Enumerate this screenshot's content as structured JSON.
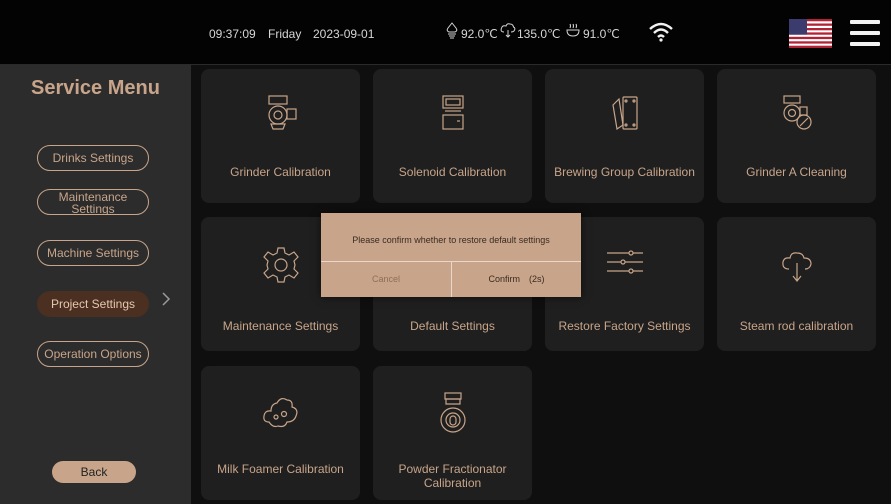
{
  "status": {
    "time": "09:37:09",
    "day": "Friday",
    "date": "2023-09-01",
    "temp1": "92.0℃",
    "temp2": "135.0℃",
    "temp3": "91.0℃"
  },
  "sidebar": {
    "title": "Service Menu",
    "items": [
      {
        "label": "Drinks Settings"
      },
      {
        "label": "Maintenance Settings"
      },
      {
        "label": "Machine Settings"
      },
      {
        "label": "Project Settings"
      },
      {
        "label": "Operation Options"
      }
    ],
    "back": "Back"
  },
  "tiles": [
    {
      "label": "Grinder Calibration",
      "icon": "grinder-icon"
    },
    {
      "label": "Solenoid Calibration",
      "icon": "solenoid-icon"
    },
    {
      "label": "Brewing Group Calibration",
      "icon": "brewing-group-icon"
    },
    {
      "label": "Grinder A Cleaning",
      "icon": "grinder-clean-icon"
    },
    {
      "label": "Maintenance Settings",
      "icon": "gear-icon"
    },
    {
      "label": "Default Settings",
      "icon": "default-settings-icon"
    },
    {
      "label": "Restore Factory Settings",
      "icon": "sliders-icon"
    },
    {
      "label": "Steam rod calibration",
      "icon": "steam-icon"
    },
    {
      "label": "Milk Foamer Calibration",
      "icon": "milk-foam-icon"
    },
    {
      "label": "Powder Fractionator Calibration",
      "icon": "powder-icon"
    }
  ],
  "dialog": {
    "message": "Please confirm whether to restore default settings",
    "cancel": "Cancel",
    "confirm": "Confirm　(2s)"
  },
  "colors": {
    "accent": "#c8a58a",
    "sidebar_bg": "#2c2c2c",
    "tile_bg": "#1f1f1f",
    "active": "#4b2f20"
  }
}
